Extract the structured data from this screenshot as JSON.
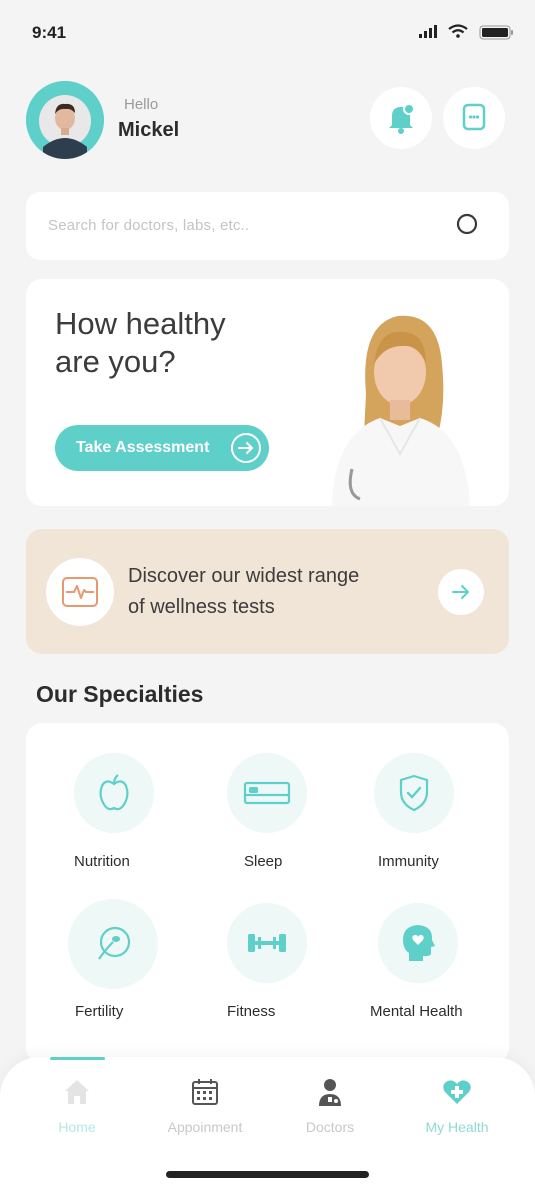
{
  "status_bar": {
    "time": "9:41"
  },
  "header": {
    "greeting": "Hello",
    "username": "Mickel"
  },
  "search": {
    "placeholder": "Search for doctors, labs, etc.."
  },
  "hero": {
    "title_line1": "How healthy",
    "title_line2": "are you?",
    "button_label": "Take Assessment"
  },
  "wellness": {
    "line1": "Discover our widest range",
    "line2": "of wellness tests"
  },
  "specialties": {
    "title": "Our Specialties",
    "items": [
      {
        "label": "Nutrition",
        "icon": "apple-icon"
      },
      {
        "label": "Sleep",
        "icon": "bed-icon"
      },
      {
        "label": "Immunity",
        "icon": "shield-icon"
      },
      {
        "label": "Fertility",
        "icon": "sperm-icon"
      },
      {
        "label": "Fitness",
        "icon": "dumbbell-icon"
      },
      {
        "label": "Mental Health",
        "icon": "head-heart-icon"
      }
    ]
  },
  "bottom_nav": {
    "items": [
      {
        "label": "Home",
        "icon": "home-icon"
      },
      {
        "label": "Appoinment",
        "icon": "calendar-icon"
      },
      {
        "label": "Doctors",
        "icon": "doctor-icon"
      },
      {
        "label": "My Health",
        "icon": "heart-plus-icon"
      }
    ],
    "active_index": 0
  },
  "colors": {
    "accent": "#5fcfc9",
    "wellness_bg": "#f1e5d8",
    "page_bg": "#f4f4f4"
  }
}
